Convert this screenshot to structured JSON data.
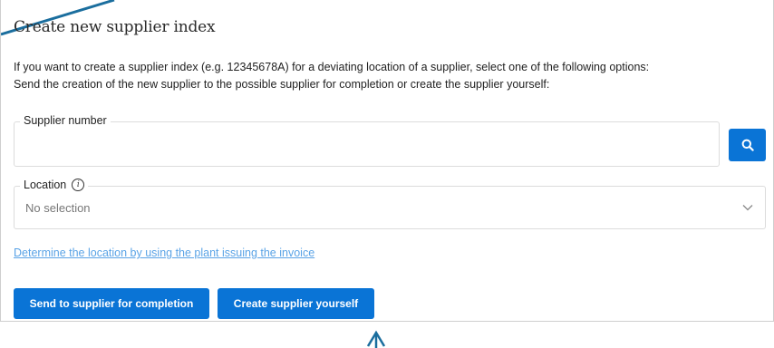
{
  "title": "Create new supplier index",
  "description": {
    "line1": "If you want to create a supplier index (e.g. 12345678A) for a deviating location of a supplier, select one of the following options:",
    "line2": "Send the creation of the new supplier to the possible supplier for completion or create the supplier yourself:"
  },
  "supplier_field": {
    "label": "Supplier number",
    "value": "",
    "search_icon": "search-icon"
  },
  "location_field": {
    "label": "Location",
    "info_icon": "info-icon",
    "selected": "No selection",
    "chevron_icon": "chevron-down-icon"
  },
  "link_text": "Determine the location by using the plant issuing the invoice",
  "buttons": {
    "send": "Send to supplier for completion",
    "create": "Create supplier yourself"
  },
  "colors": {
    "primary": "#0a74d6",
    "link": "#5aa3e6",
    "annotation": "#1b6e9e"
  }
}
